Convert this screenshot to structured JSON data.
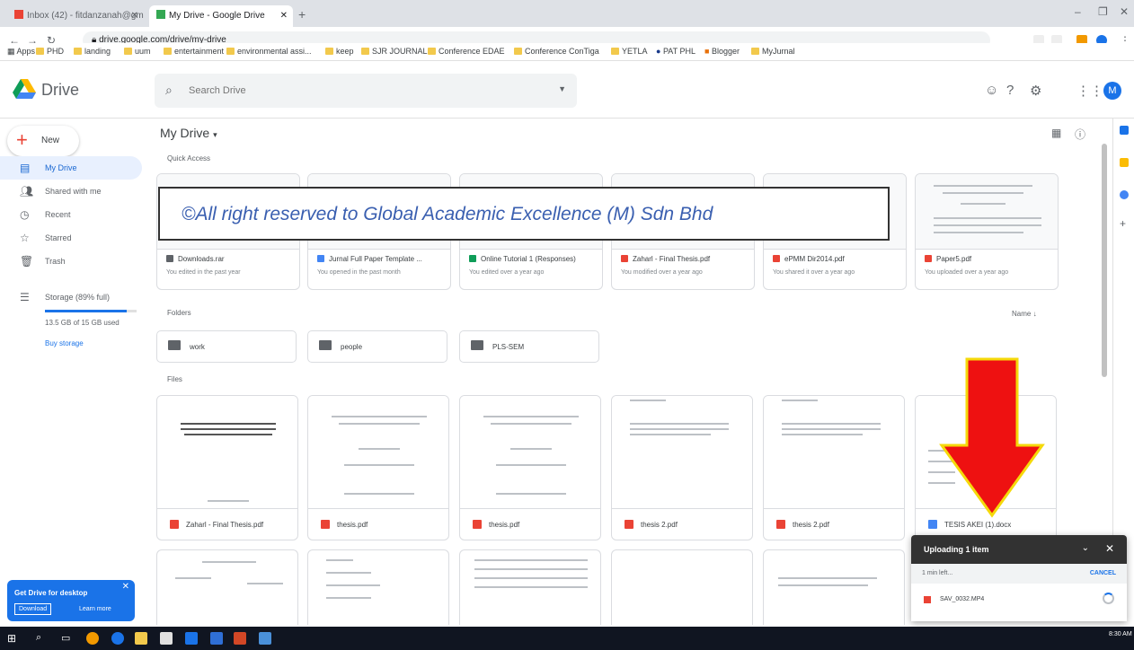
{
  "browser": {
    "tabs": [
      {
        "label": "Inbox (42) - fitdanzanah@gmail..."
      },
      {
        "label": "My Drive - Google Drive"
      }
    ],
    "url": "drive.google.com/drive/my-drive",
    "bookmarks": [
      "Apps",
      "PHD",
      "landing",
      "uum",
      "entertainment",
      "environmental assi...",
      "keep",
      "SJR JOURNAL",
      "Conference EDAE",
      "Conference ConTiga",
      "YETLA",
      "PAT PHL",
      "Blogger",
      "MyJurnal"
    ]
  },
  "header": {
    "brand": "Drive",
    "search_placeholder": "Search Drive"
  },
  "sidebar": {
    "new_label": "New",
    "items": [
      {
        "label": "My Drive",
        "icon": "drive-icon"
      },
      {
        "label": "Shared with me",
        "icon": "people-icon"
      },
      {
        "label": "Recent",
        "icon": "clock-icon"
      },
      {
        "label": "Starred",
        "icon": "star-icon"
      },
      {
        "label": "Trash",
        "icon": "trash-icon"
      }
    ],
    "storage_label": "Storage (89% full)",
    "storage_fraction": 0.89,
    "storage_used": "13.5 GB of 15 GB used",
    "buy_storage": "Buy storage"
  },
  "promo": {
    "title": "Get Drive for desktop",
    "download": "Download",
    "learn_more": "Learn more"
  },
  "main": {
    "title": "My Drive",
    "quick_access_label": "Quick Access",
    "folders_label": "Folders",
    "files_label": "Files",
    "sort_label": "Name",
    "quick_access": [
      {
        "name": "Downloads.rar",
        "sub": "You edited in the past year"
      },
      {
        "name": "Jurnal Full Paper Template ...",
        "sub": "You opened in the past month"
      },
      {
        "name": "Online Tutorial 1 (Responses)",
        "sub": "You edited over a year ago"
      },
      {
        "name": "Zaharl - Final Thesis.pdf",
        "sub": "You modified over a year ago"
      },
      {
        "name": "ePMM Dir2014.pdf",
        "sub": "You shared it over a year ago"
      },
      {
        "name": "Paper5.pdf",
        "sub": "You uploaded over a year ago"
      }
    ],
    "folders": [
      {
        "name": "work"
      },
      {
        "name": "people"
      },
      {
        "name": "PLS-SEM"
      }
    ],
    "files": [
      {
        "name": "Zaharl - Final Thesis.pdf"
      },
      {
        "name": "thesis.pdf"
      },
      {
        "name": "thesis.pdf"
      },
      {
        "name": "thesis 2.pdf"
      },
      {
        "name": "thesis 2.pdf"
      },
      {
        "name": "TESIS AKEI (1).docx"
      }
    ]
  },
  "watermark": "©All right reserved to Global Academic Excellence (M) Sdn Bhd",
  "upload": {
    "title": "Uploading 1 item",
    "time_left": "1 min left...",
    "cancel": "CANCEL",
    "file": "SAV_0032.MP4"
  },
  "taskbar": {
    "time": "8:30 AM"
  },
  "colors": {
    "accent": "#1a73e8",
    "pdf": "#ea4335",
    "arrow": "#ee1111",
    "arrow_border": "#f5d90a"
  }
}
